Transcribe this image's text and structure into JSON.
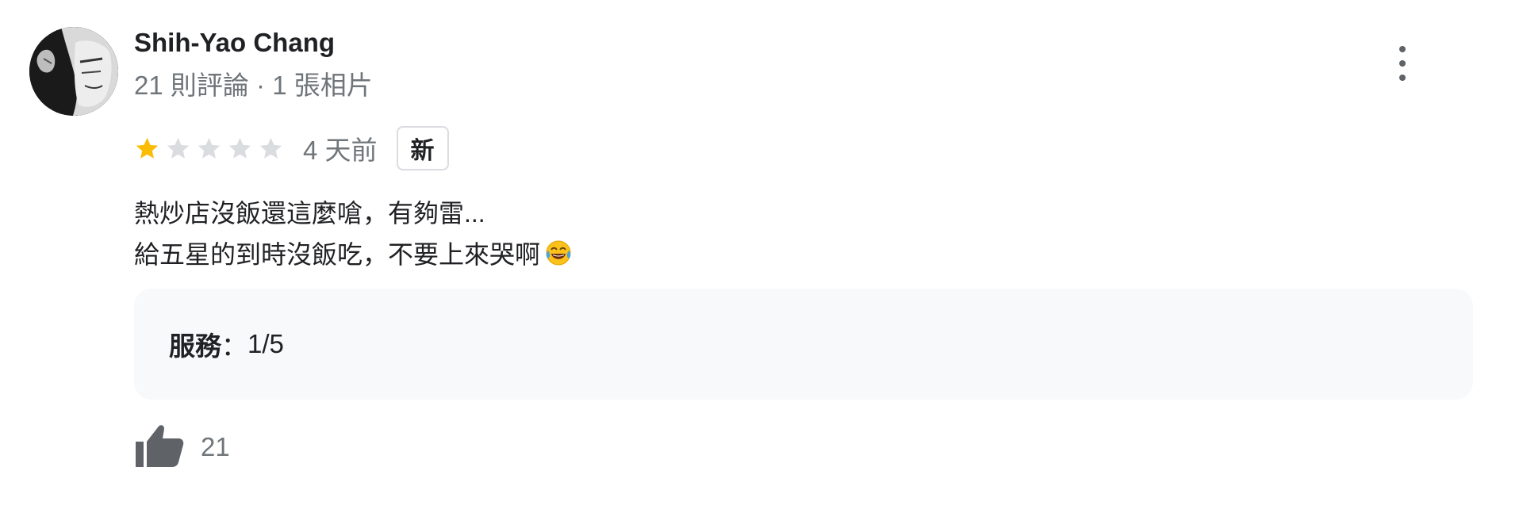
{
  "review": {
    "author": "Shih-Yao Chang",
    "author_meta": "21 則評論 · 1 張相片",
    "rating": 1,
    "rating_max": 5,
    "time": "4 天前",
    "badge": "新",
    "text_lines": [
      "熱炒店沒飯還這麼嗆，有夠雷...",
      "給五星的到時沒飯吃，不要上來哭啊"
    ],
    "emoji": "😂",
    "attribute": {
      "label": "服務",
      "separator": "：",
      "value": "1/5"
    },
    "like_count": "21"
  },
  "colors": {
    "star_filled": "#fbbc04",
    "star_empty": "#dadce0",
    "secondary_text": "#70757a",
    "icon_gray": "#5f6368",
    "panel_bg": "#f8f9fa"
  },
  "icons": {
    "more": "more-vert-icon",
    "like": "thumb-up-icon",
    "star": "star-icon"
  }
}
